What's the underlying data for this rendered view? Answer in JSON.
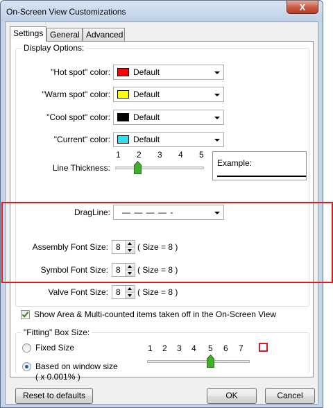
{
  "window": {
    "title": "On-Screen View Customizations",
    "close_glyph": "X"
  },
  "tabs": [
    {
      "label": "Settings",
      "active": true
    },
    {
      "label": "General",
      "active": false
    },
    {
      "label": "Advanced",
      "active": false
    }
  ],
  "display_options": {
    "title": "Display Options:",
    "hot_spot": {
      "label": "\"Hot spot\" color:",
      "value": "Default",
      "color": "#ff0000"
    },
    "warm_spot": {
      "label": "\"Warm spot\" color:",
      "value": "Default",
      "color": "#ffff00"
    },
    "cool_spot": {
      "label": "\"Cool spot\" color:",
      "value": "Default",
      "color": "#000000"
    },
    "current": {
      "label": "\"Current\" color:",
      "value": "Default",
      "color": "#33ddee"
    },
    "line_thickness": {
      "label": "Line Thickness:",
      "ticks": [
        "1",
        "2",
        "3",
        "4",
        "5"
      ],
      "value": 2,
      "example_label": "Example:"
    },
    "dragline": {
      "label": "DragLine:",
      "value": "— — — — -"
    }
  },
  "fonts": {
    "assembly": {
      "label": "Assembly Font Size:",
      "value": "8",
      "note": "( Size = 8 )"
    },
    "symbol": {
      "label": "Symbol Font Size:",
      "value": "8",
      "note": "( Size = 8 )"
    },
    "valve": {
      "label": "Valve Font Size:",
      "value": "8",
      "note": "( Size = 8 )"
    }
  },
  "show_area_checkbox": {
    "label": "Show Area & Multi-counted items taken off in the On-Screen View",
    "checked": true
  },
  "fitting_box": {
    "title": "\"Fitting\" Box Size:",
    "fixed_size_label": "Fixed Size",
    "window_size_label": "Based on window size",
    "window_size_sub": "( x 0.001% )",
    "selected": "window_size",
    "ticks": [
      "1",
      "2",
      "3",
      "4",
      "5",
      "6",
      "7"
    ],
    "value": 5,
    "preview_color": "#e0171c"
  },
  "buttons": {
    "reset": "Reset to defaults",
    "ok": "OK",
    "cancel": "Cancel"
  },
  "colors": {
    "highlight": "#e0171c",
    "check": "#3d7a18",
    "thumb": "#3fae2a"
  }
}
